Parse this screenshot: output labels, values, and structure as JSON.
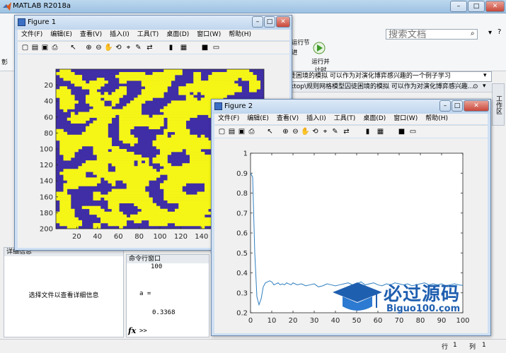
{
  "app": {
    "title": "MATLAB R2018a"
  },
  "search": {
    "placeholder": "搜索文档"
  },
  "ribbon": {
    "run_section_label": "运行节",
    "run_advance_label": "进",
    "run_and_time_label": "运行并计时"
  },
  "path": {
    "current": "徒困境的模拟 可以作为对演化博弈感兴趣的一个例子学习",
    "doc": "ktop\\规则网格模型囚徒困境的模拟 可以作为对演化博弈感兴趣..."
  },
  "right_panel": {
    "label": "工作区"
  },
  "detail_panel": {
    "title": "详细信息",
    "message": "选择文件以查看详细信息"
  },
  "command_window": {
    "title": "命令行窗口",
    "lines": [
      "100",
      "",
      "",
      "a =",
      "",
      "0.3368"
    ],
    "fx": "fx",
    "prompt": ">>"
  },
  "status_bar": {
    "row_label": "行",
    "row_value": "1",
    "col_label": "列",
    "col_value": "1"
  },
  "menus": [
    "文件(F)",
    "编辑(E)",
    "查看(V)",
    "插入(I)",
    "工具(T)",
    "桌面(D)",
    "窗口(W)",
    "帮助(H)"
  ],
  "figure1": {
    "title": "Figure 1",
    "xticks": [
      20,
      40,
      60,
      80,
      100,
      120,
      140
    ],
    "yticks": [
      20,
      40,
      60,
      80,
      100,
      120,
      140,
      160,
      180,
      200
    ],
    "grid_size": 200,
    "colors": {
      "defector": "#3f2ea5",
      "cooperator": "#f5f516"
    }
  },
  "figure2": {
    "title": "Figure 2",
    "chart_data": {
      "type": "line",
      "x": [
        0,
        1,
        2,
        3,
        4,
        5,
        6,
        7,
        8,
        9,
        10,
        11,
        12,
        13,
        14,
        15,
        16,
        17,
        18,
        19,
        20,
        22,
        24,
        26,
        28,
        30,
        32,
        34,
        36,
        38,
        40,
        42,
        44,
        46,
        48,
        50,
        52,
        54,
        56,
        58,
        60,
        62,
        64,
        66,
        68,
        70,
        72,
        74,
        76,
        78,
        80,
        82,
        84,
        86,
        88,
        90,
        92,
        94,
        96,
        98,
        100
      ],
      "values": [
        0.9,
        0.88,
        0.5,
        0.28,
        0.24,
        0.27,
        0.33,
        0.35,
        0.355,
        0.36,
        0.355,
        0.34,
        0.345,
        0.35,
        0.34,
        0.345,
        0.34,
        0.35,
        0.345,
        0.34,
        0.35,
        0.34,
        0.345,
        0.335,
        0.34,
        0.345,
        0.33,
        0.335,
        0.345,
        0.34,
        0.335,
        0.34,
        0.345,
        0.35,
        0.34,
        0.345,
        0.355,
        0.34,
        0.345,
        0.35,
        0.34,
        0.335,
        0.345,
        0.34,
        0.35,
        0.345,
        0.34,
        0.345,
        0.335,
        0.34,
        0.345,
        0.35,
        0.34,
        0.345,
        0.34,
        0.345,
        0.335,
        0.34,
        0.345,
        0.34,
        0.337
      ],
      "xlim": [
        0,
        100
      ],
      "ylim": [
        0.2,
        1
      ],
      "xticks": [
        0,
        10,
        20,
        30,
        40,
        50,
        60,
        70,
        80,
        90,
        100
      ],
      "yticks": [
        0.2,
        0.3,
        0.4,
        0.5,
        0.6,
        0.7,
        0.8,
        0.9,
        1
      ],
      "line_color": "#2f7fc1"
    }
  },
  "watermark": {
    "text": "必过源码",
    "url_text": "Biguo100.com"
  }
}
